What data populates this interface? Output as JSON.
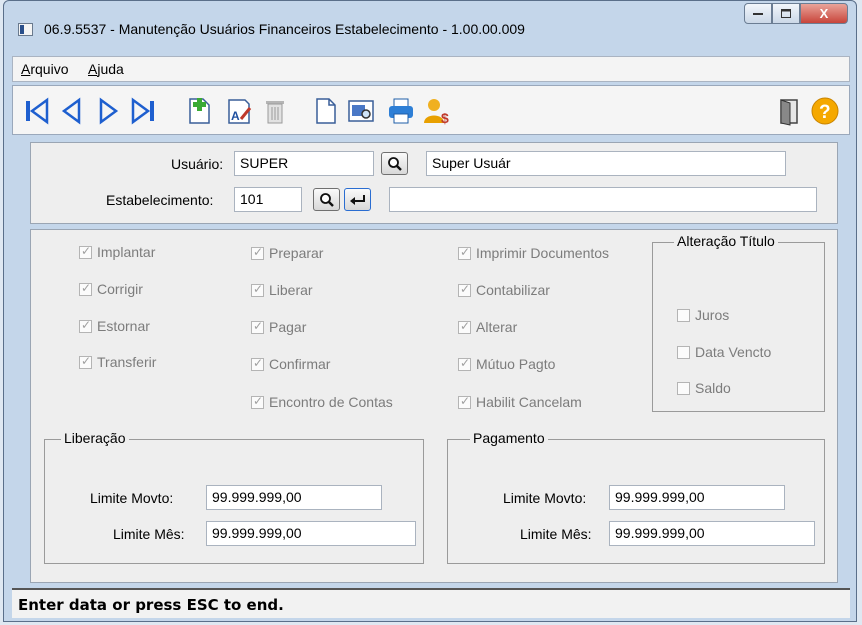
{
  "window": {
    "title": "06.9.5537 - Manutenção Usuários Financeiros Estabelecimento - 1.00.00.009"
  },
  "window_buttons": {
    "close_label": "X"
  },
  "menu": {
    "arquivo": "Arquivo",
    "ajuda": "Ajuda"
  },
  "form": {
    "usuario_label": "Usuário:",
    "usuario_code": "SUPER",
    "usuario_name": "Super Usuár",
    "estab_label": "Estabelecimento:",
    "estab_code": "101",
    "estab_desc": ""
  },
  "perms": {
    "implantar": "Implantar",
    "corrigir": "Corrigir",
    "estornar": "Estornar",
    "transferir": "Transferir",
    "preparar": "Preparar",
    "liberar": "Liberar",
    "pagar": "Pagar",
    "confirmar": "Confirmar",
    "encontro": "Encontro de Contas",
    "imprimir": "Imprimir Documentos",
    "contabilizar": "Contabilizar",
    "alterar": "Alterar",
    "mutuo": "Mútuo Pagto",
    "habilit": "Habilit Cancelam"
  },
  "alteracao": {
    "title": "Alteração Título",
    "juros": "Juros",
    "data_vencto": "Data Vencto",
    "saldo": "Saldo"
  },
  "liberacao": {
    "title": "Liberação",
    "movto_label": "Limite Movto:",
    "movto_value": "99.999.999,00",
    "mes_label": "Limite Mês:",
    "mes_value": "99.999.999,00"
  },
  "pagamento": {
    "title": "Pagamento",
    "movto_label": "Limite Movto:",
    "movto_value": "99.999.999,00",
    "mes_label": "Limite Mês:",
    "mes_value": "99.999.999,00"
  },
  "status": {
    "text": "Enter data or press ESC to end."
  },
  "colors": {
    "toolbar_nav": "#1e5fcf",
    "help": "#f5a800",
    "print": "#2e7fd6"
  }
}
